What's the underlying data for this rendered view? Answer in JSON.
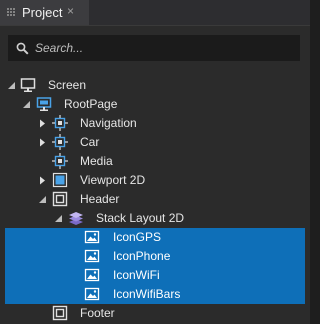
{
  "panel": {
    "title": "Project",
    "close_glyph": "×"
  },
  "search": {
    "placeholder": "Search...",
    "value": ""
  },
  "colors": {
    "selection": "#0e6fb8",
    "background": "#2b2b2b",
    "icon_blue": "#4aa3e8"
  },
  "tree": [
    {
      "label": "Screen",
      "icon": "screen-icon",
      "expander": "expanded",
      "selected": false
    },
    {
      "label": "RootPage",
      "icon": "page-icon",
      "expander": "expanded",
      "selected": false
    },
    {
      "label": "Navigation",
      "icon": "node-icon",
      "expander": "collapsed",
      "selected": false
    },
    {
      "label": "Car",
      "icon": "node-icon",
      "expander": "collapsed",
      "selected": false
    },
    {
      "label": "Media",
      "icon": "node-icon",
      "expander": "none",
      "selected": false
    },
    {
      "label": "Viewport 2D",
      "icon": "viewport-icon",
      "expander": "collapsed",
      "selected": false
    },
    {
      "label": "Header",
      "icon": "empty-node-icon",
      "expander": "expanded",
      "selected": false
    },
    {
      "label": "Stack Layout 2D",
      "icon": "stack-layout-icon",
      "expander": "expanded",
      "selected": false
    },
    {
      "label": "IconGPS",
      "icon": "image-icon",
      "expander": "none",
      "selected": true
    },
    {
      "label": "IconPhone",
      "icon": "image-icon",
      "expander": "none",
      "selected": true
    },
    {
      "label": "IconWiFi",
      "icon": "image-icon",
      "expander": "none",
      "selected": true
    },
    {
      "label": "IconWifiBars",
      "icon": "image-icon",
      "expander": "none",
      "selected": true
    },
    {
      "label": "Footer",
      "icon": "empty-node-icon",
      "expander": "none",
      "selected": false
    }
  ]
}
